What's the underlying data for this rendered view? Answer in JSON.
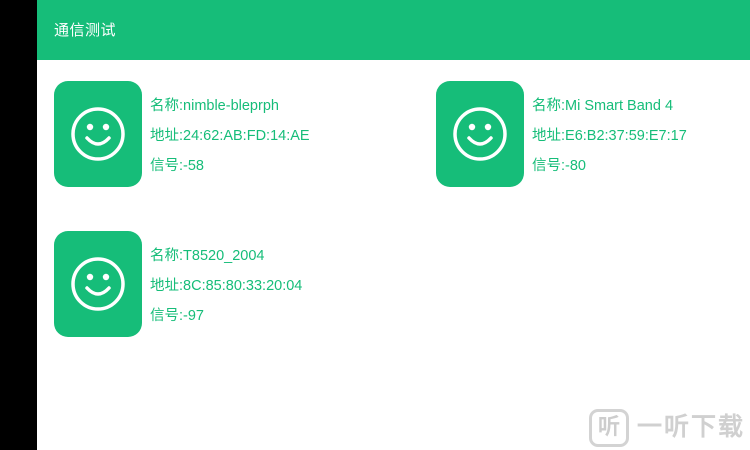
{
  "app": {
    "title": "通信测试"
  },
  "devices": [
    {
      "name": "名称:nimble-bleprph",
      "address": "地址:24:62:AB:FD:14:AE",
      "signal": "信号:-58",
      "icon": "smiley-face-icon"
    },
    {
      "name": "名称:Mi Smart Band 4",
      "address": "地址:E6:B2:37:59:E7:17",
      "signal": "信号:-80",
      "icon": "smiley-face-icon"
    },
    {
      "name": "名称:T8520_2004",
      "address": "地址:8C:85:80:33:20:04",
      "signal": "信号:-97",
      "icon": "smiley-face-icon"
    }
  ],
  "watermark": {
    "icon_glyph": "听",
    "text": "一听下载"
  },
  "colors": {
    "accent": "#16bd79",
    "background": "#ffffff",
    "frame": "#000000"
  }
}
